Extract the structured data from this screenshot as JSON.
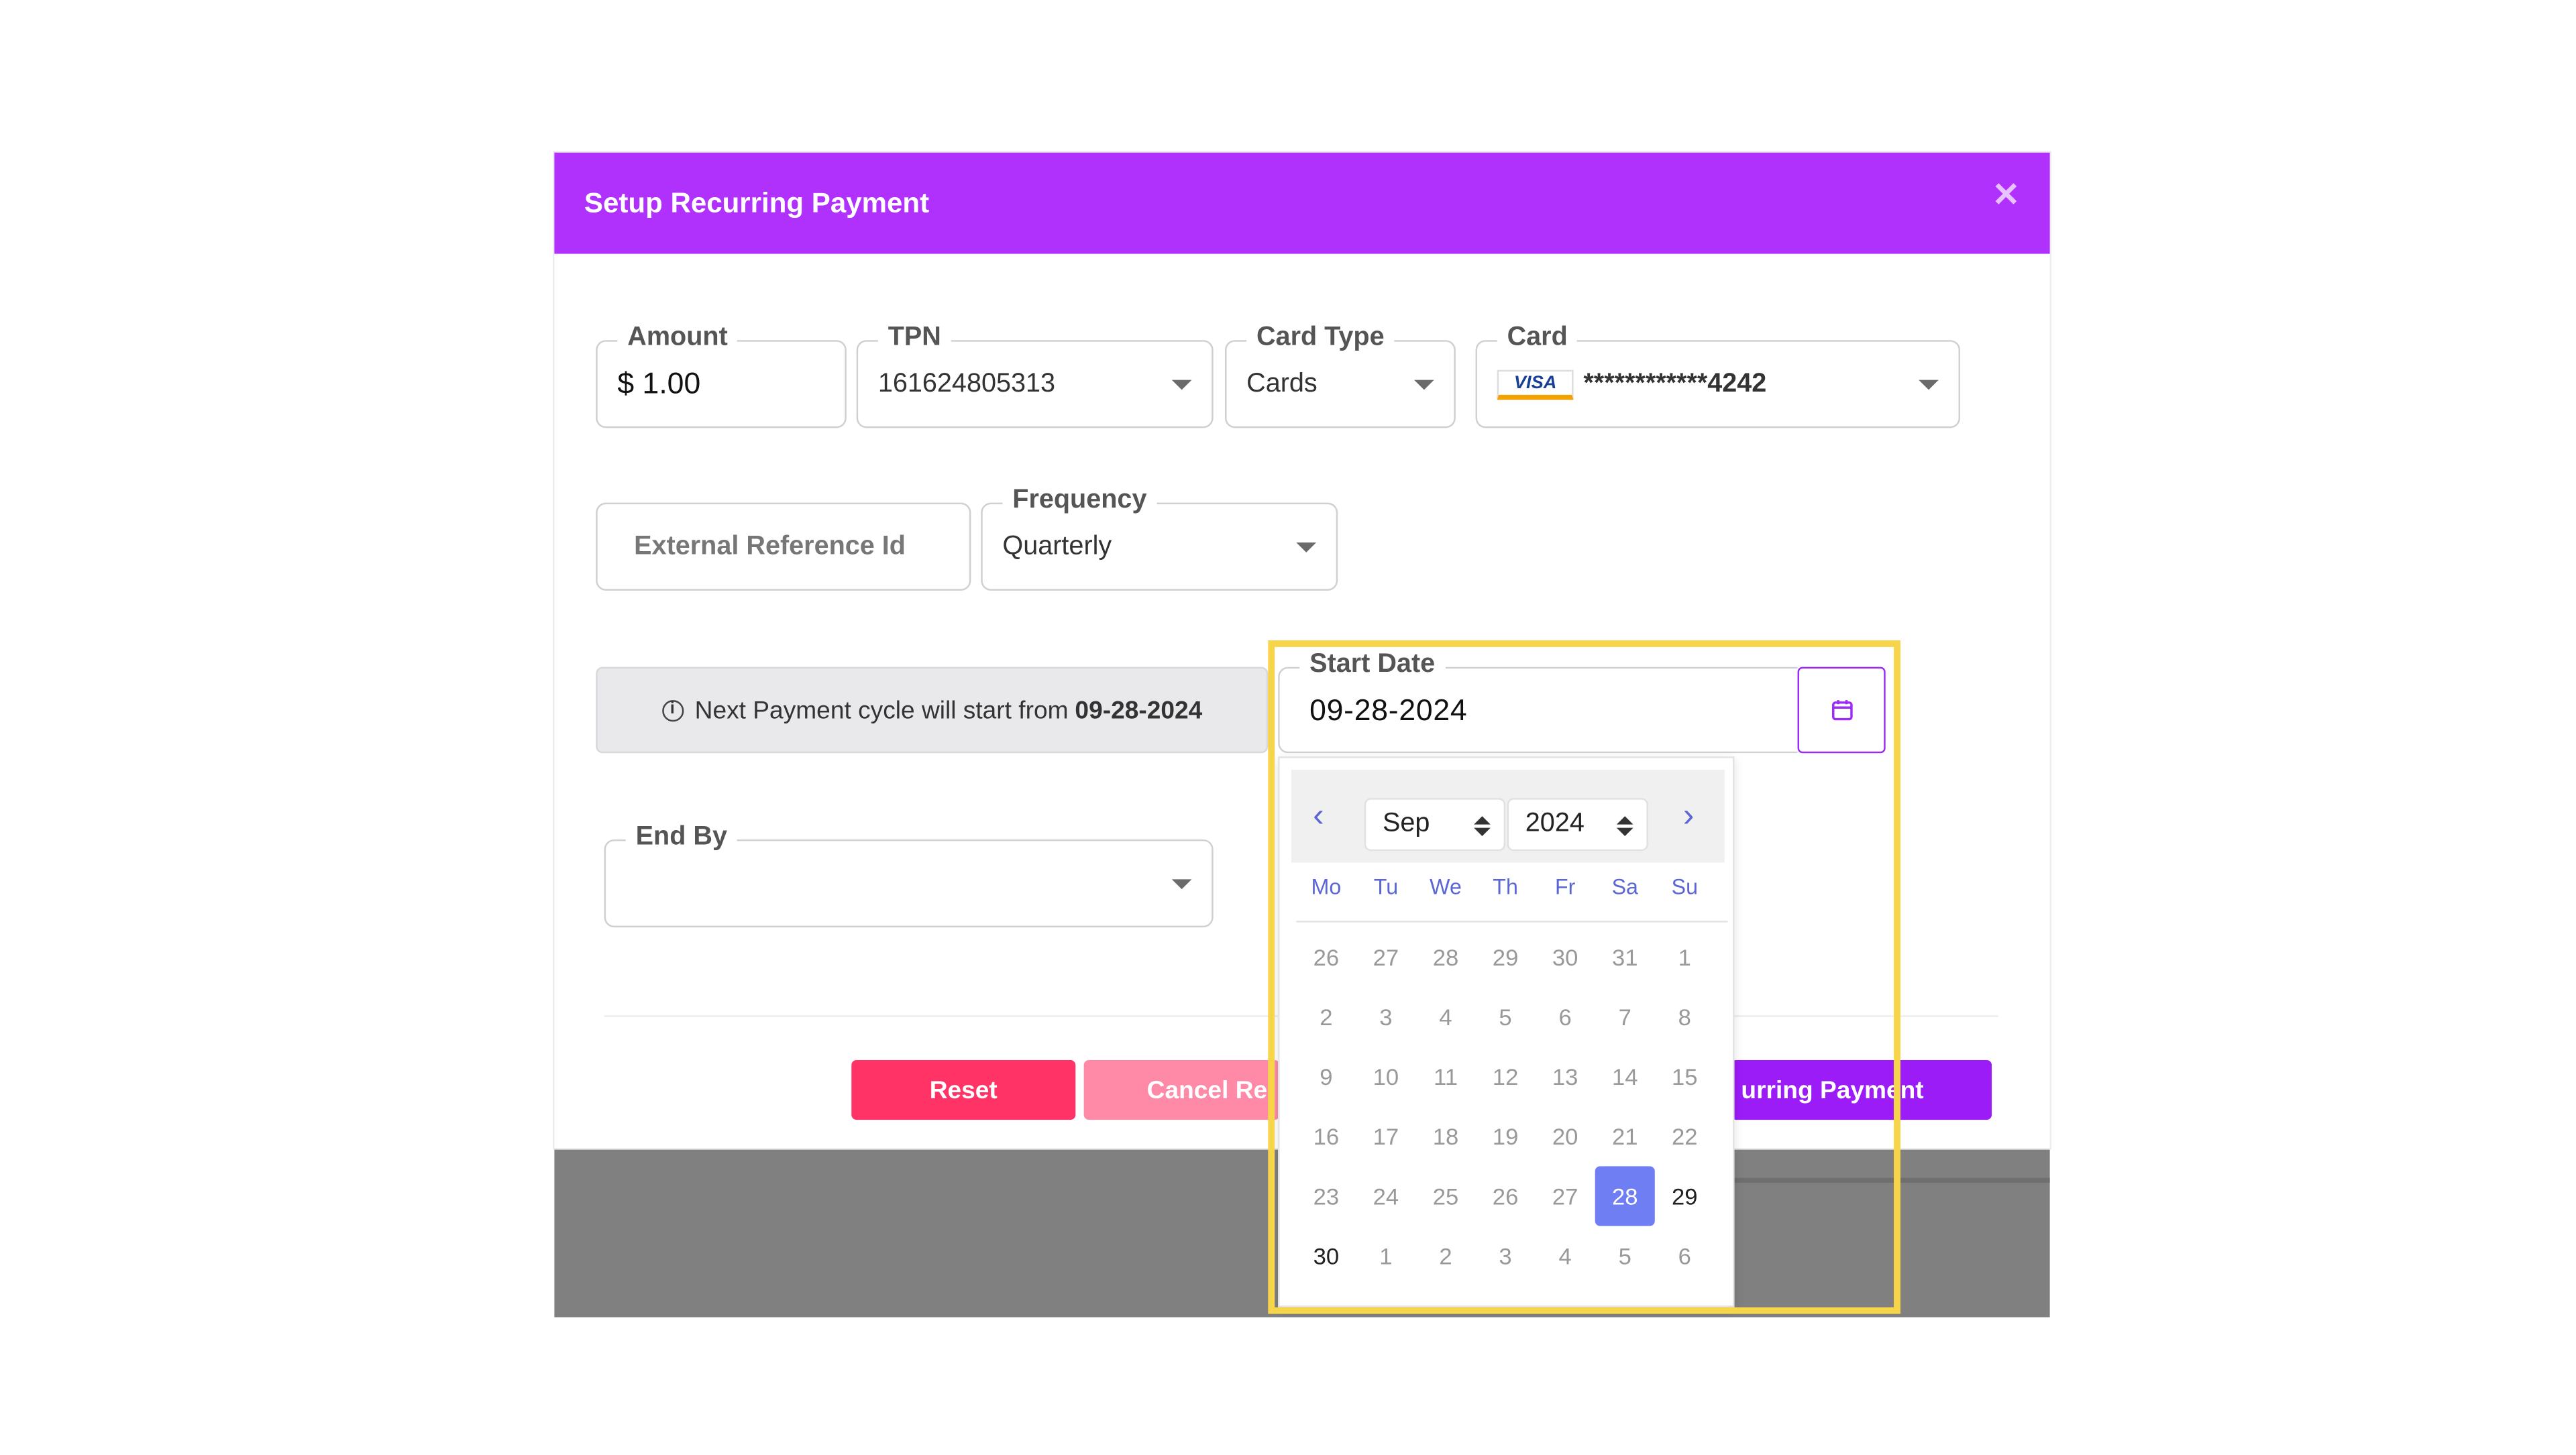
{
  "modal": {
    "title": "Setup Recurring Payment",
    "close_icon": "close-icon",
    "header_color": "#b131fc"
  },
  "fields": {
    "amount": {
      "label": "Amount",
      "value": "$ 1.00"
    },
    "tpn": {
      "label": "TPN",
      "value": "161624805313"
    },
    "card_type": {
      "label": "Card Type",
      "value": "Cards"
    },
    "card": {
      "label": "Card",
      "brand": "VISA",
      "masked": "************4242"
    },
    "external_ref": {
      "placeholder": "External Reference Id"
    },
    "frequency": {
      "label": "Frequency",
      "value": "Quarterly"
    },
    "start_date": {
      "label": "Start Date",
      "value": "09-28-2024"
    },
    "end_by": {
      "label": "End By",
      "value": ""
    }
  },
  "info": {
    "text": "Next Payment cycle will start from",
    "date": "09-28-2024"
  },
  "calendar": {
    "month": "Sep",
    "year": "2024",
    "weekdays": [
      "Mo",
      "Tu",
      "We",
      "Th",
      "Fr",
      "Sa",
      "Su"
    ],
    "weeks": [
      [
        "26",
        "27",
        "28",
        "29",
        "30",
        "31",
        "1"
      ],
      [
        "2",
        "3",
        "4",
        "5",
        "6",
        "7",
        "8"
      ],
      [
        "9",
        "10",
        "11",
        "12",
        "13",
        "14",
        "15"
      ],
      [
        "16",
        "17",
        "18",
        "19",
        "20",
        "21",
        "22"
      ],
      [
        "23",
        "24",
        "25",
        "26",
        "27",
        "28",
        "29"
      ],
      [
        "30",
        "1",
        "2",
        "3",
        "4",
        "5",
        "6"
      ]
    ],
    "selected": "28",
    "accent": "#6f7ef2"
  },
  "buttons": {
    "reset": "Reset",
    "cancel": "Cancel Re",
    "setup": "urring Payment"
  }
}
